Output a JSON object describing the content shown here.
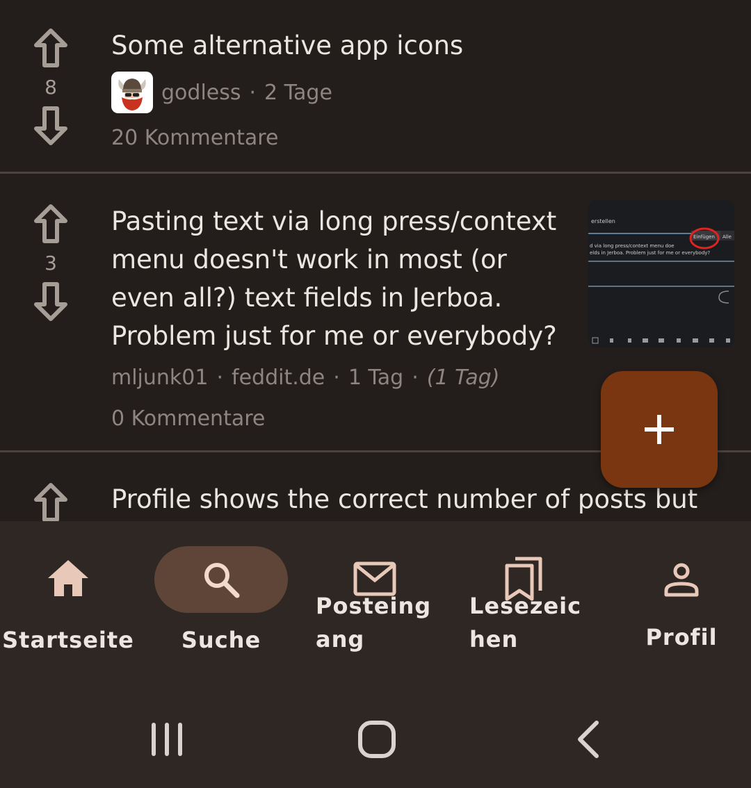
{
  "posts": [
    {
      "title": "Some alternative app icons",
      "score": "8",
      "author": "godless",
      "age": "2 Tage",
      "comments": "20 Kommentare"
    },
    {
      "title": "Pasting text via long press/context menu doesn't work in most (or even all?) text fields in Jerboa. Problem just for me or everybody?",
      "score": "3",
      "author": "mljunk01",
      "community": "feddit.de",
      "age": "1 Tag",
      "edited": "(1 Tag)",
      "comments": "0 Kommentare"
    },
    {
      "title": "Profile shows the correct number of posts but"
    }
  ],
  "thumbnail": {
    "header": "erstellen",
    "line1": "d via long press/context menu doe",
    "line2": "elds in Jerboa. Problem just for me or everybody?",
    "chip": "Einfügen",
    "chip2": "Alle"
  },
  "fab": {
    "icon": "plus-icon"
  },
  "nav": {
    "home": "Startseite",
    "search": "Suche",
    "inbox": "Posteing\nang",
    "inbox_l1": "Posteing",
    "inbox_l2": "ang",
    "bookmarks_l1": "Lesezeic",
    "bookmarks_l2": "hen",
    "profile": "Profil"
  },
  "colors": {
    "background": "#231e1b",
    "navbar": "#2f2723",
    "accent": "#7a3511",
    "pill": "#5e4537"
  }
}
